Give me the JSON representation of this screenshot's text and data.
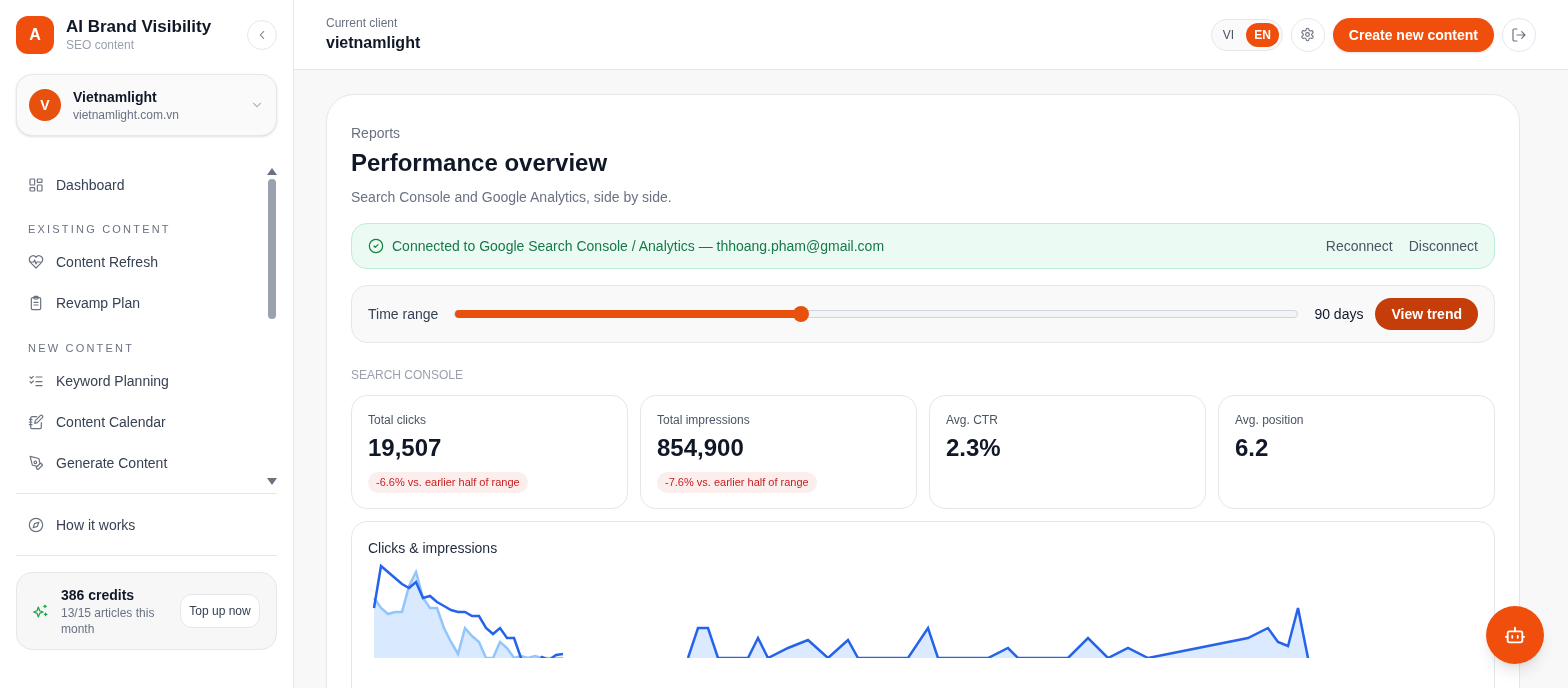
{
  "brand": {
    "initial": "A",
    "name": "AI Brand Visibility",
    "subtitle": "SEO content"
  },
  "client_switcher": {
    "initial": "V",
    "name": "Vietnamlight",
    "domain": "vietnamlight.com.vn"
  },
  "sidebar": {
    "sections": [
      {
        "items": [
          {
            "label": "Dashboard"
          }
        ]
      },
      {
        "heading": "EXISTING CONTENT",
        "items": [
          {
            "label": "Content Refresh"
          },
          {
            "label": "Revamp Plan"
          }
        ]
      },
      {
        "heading": "NEW CONTENT",
        "items": [
          {
            "label": "Keyword Planning"
          },
          {
            "label": "Content Calendar"
          },
          {
            "label": "Generate Content"
          }
        ]
      }
    ],
    "footer_link": "How it works",
    "credits": {
      "title": "386 credits",
      "detail": "13/15 articles this month",
      "button": "Top up now"
    }
  },
  "header": {
    "caption": "Current client",
    "client": "vietnamlight",
    "languages": [
      {
        "label": "VI",
        "selected": false
      },
      {
        "label": "EN",
        "selected": true
      }
    ],
    "primary_button": "Create new content"
  },
  "report": {
    "eyebrow": "Reports",
    "title": "Performance overview",
    "subtitle": "Search Console and Google Analytics, side by side.",
    "connection": {
      "message": "Connected to Google Search Console / Analytics — thhoang.pham@gmail.com",
      "actions": [
        "Reconnect",
        "Disconnect"
      ]
    },
    "time_range": {
      "label": "Time range",
      "level": 0.41,
      "reading": "90 days",
      "button": "View trend"
    },
    "section_title": "SEARCH CONSOLE",
    "stats": [
      {
        "label": "Total clicks",
        "value": "19,507",
        "delta": "-6.6% vs. earlier half of range"
      },
      {
        "label": "Total impressions",
        "value": "854,900",
        "delta": "-7.6% vs. earlier half of range"
      },
      {
        "label": "Avg. CTR",
        "value": "2.3%"
      },
      {
        "label": "Avg. position",
        "value": "6.2"
      }
    ],
    "chart_title": "Clicks & impressions"
  }
}
